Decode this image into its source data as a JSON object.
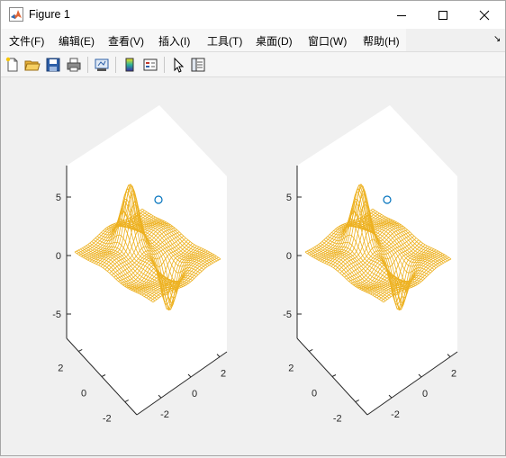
{
  "window": {
    "title": "Figure 1",
    "controls": {
      "minimize": "minimize",
      "maximize": "maximize",
      "close": "close"
    }
  },
  "menu": {
    "items": [
      {
        "label": "文件(F)"
      },
      {
        "label": "编辑(E)"
      },
      {
        "label": "查看(V)"
      },
      {
        "label": "插入(I)"
      },
      {
        "label": "工具(T)"
      },
      {
        "label": "桌面(D)"
      },
      {
        "label": "窗口(W)"
      },
      {
        "label": "帮助(H)"
      }
    ],
    "overflow_glyph": "↘"
  },
  "toolbar": {
    "buttons": [
      "new-figure-icon",
      "open-file-icon",
      "save-icon",
      "print-icon",
      "link-plot-icon",
      "insert-colorbar-icon",
      "insert-legend-icon",
      "edit-plot-icon",
      "property-inspector-icon"
    ]
  },
  "colors": {
    "mesh": "#edb120",
    "marker": "#0072bd",
    "axes": "#262626",
    "titlebar_bg": "#ffffff",
    "figure_bg": "#f0f0f0",
    "axes_bg": "#ffffff"
  },
  "chart_data": [
    {
      "type": "mesh3d",
      "z_ticks": [
        "5",
        "0",
        "-5"
      ],
      "x_ticks": [
        "2",
        "0",
        "-2"
      ],
      "y_ticks": [
        "-2",
        "0",
        "2"
      ],
      "marker": {
        "shape": "circle",
        "color": "#0072bd"
      }
    },
    {
      "type": "mesh3d",
      "z_ticks": [
        "5",
        "0",
        "-5"
      ],
      "x_ticks": [
        "2",
        "0",
        "-2"
      ],
      "y_ticks": [
        "-2",
        "0",
        "2"
      ],
      "marker": {
        "shape": "circle",
        "color": "#0072bd"
      }
    }
  ]
}
